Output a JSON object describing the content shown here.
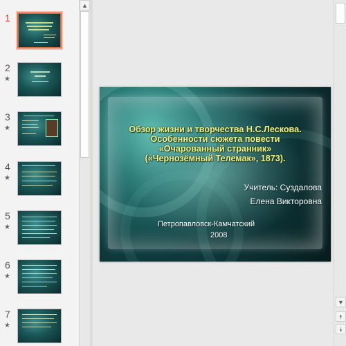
{
  "thumbnails": [
    {
      "number": "1",
      "selected": true,
      "has_animation": false
    },
    {
      "number": "2",
      "selected": false,
      "has_animation": true
    },
    {
      "number": "3",
      "selected": false,
      "has_animation": true
    },
    {
      "number": "4",
      "selected": false,
      "has_animation": true
    },
    {
      "number": "5",
      "selected": false,
      "has_animation": true
    },
    {
      "number": "6",
      "selected": false,
      "has_animation": true
    },
    {
      "number": "7",
      "selected": false,
      "has_animation": true
    }
  ],
  "icons": {
    "animation_star": "★",
    "scroll_up": "▲",
    "scroll_down": "▼",
    "prev_slide": "⯭",
    "next_slide": "⯯"
  },
  "slide": {
    "title_lines": [
      "Обзор жизни и творчества Н.С.Лескова.",
      "Особенности сюжета повести",
      "«Очарованный странник»",
      "(«Чернозёмный Телемак», 1873)."
    ],
    "teacher_line": "Учитель: Суздалова",
    "teacher_name": "Елена Викторовна",
    "city": "Петропавловск-Камчатский",
    "year": "2008"
  },
  "colors": {
    "title_yellow": "#f2f07a",
    "selection_orange": "#e2663d"
  }
}
